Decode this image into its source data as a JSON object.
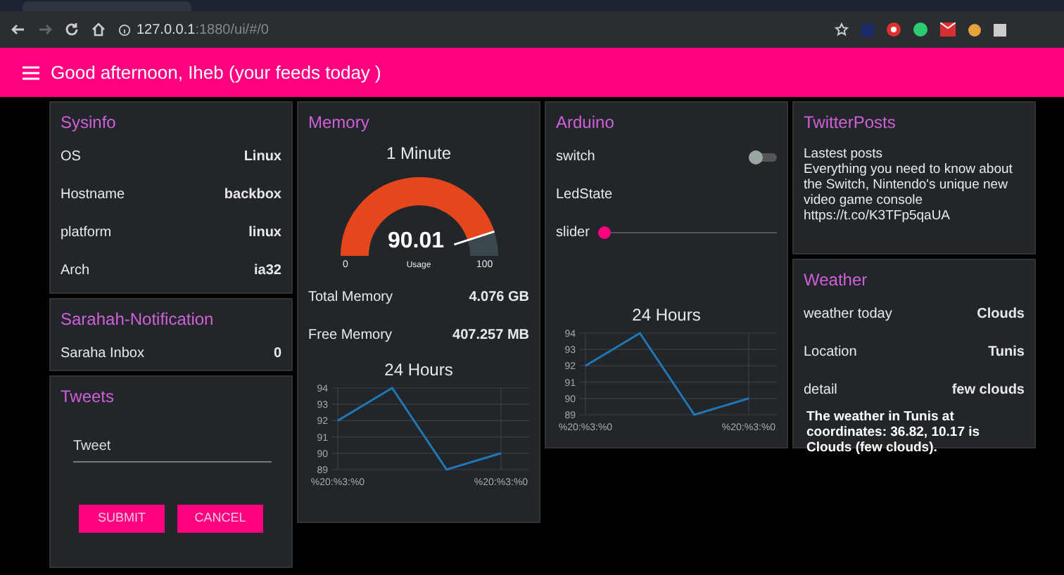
{
  "browser": {
    "url_host": "127.0.0.1",
    "url_path": ":1880/ui/#/0"
  },
  "header": {
    "title": "Good afternoon, Iheb (your feeds today )"
  },
  "sysinfo": {
    "title": "Sysinfo",
    "rows": [
      {
        "label": "OS",
        "value": "Linux"
      },
      {
        "label": "Hostname",
        "value": "backbox"
      },
      {
        "label": "platform",
        "value": "linux"
      },
      {
        "label": "Arch",
        "value": "ia32"
      }
    ]
  },
  "notification": {
    "title": "Sarahah-Notification",
    "rows": [
      {
        "label": "Saraha Inbox",
        "value": "0"
      }
    ]
  },
  "tweets": {
    "title": "Tweets",
    "field": {
      "placeholder": "Tweet"
    },
    "buttons": [
      "SUBMIT",
      "CANCEL"
    ]
  },
  "memory": {
    "title": "Memory",
    "gauge": {
      "title": "1 Minute",
      "value": "90.01",
      "min": "0",
      "max": "100",
      "label": "Usage"
    },
    "rows": [
      {
        "label": "Total Memory",
        "value": "4.076 GB"
      },
      {
        "label": "Free Memory",
        "value": "407.257 MB"
      }
    ],
    "chart": {
      "chart_data": {
        "type": "line",
        "title": "24 Hours",
        "categories": [
          "%20:%3:%0",
          null,
          null,
          "%20:%3:%0"
        ],
        "series": [
          {
            "color": "#1f77b4",
            "values": [
              92,
              94,
              89,
              90
            ]
          }
        ],
        "ylim": [
          89,
          94
        ],
        "yticks": [
          89,
          90,
          91,
          92,
          93,
          94
        ],
        "grid": true
      }
    }
  },
  "arduino": {
    "title": "Arduino",
    "switch": {
      "label": "switch",
      "on": false
    },
    "led": {
      "label": "LedState"
    },
    "slider": {
      "label": "slider",
      "level": 0
    },
    "chart": {
      "chart_data": {
        "type": "line",
        "title": "24 Hours",
        "categories": [
          "%20:%3:%0",
          null,
          null,
          "%20:%3:%0"
        ],
        "series": [
          {
            "color": "#1f77b4",
            "values": [
              92,
              94,
              89,
              90
            ]
          }
        ],
        "ylim": [
          89,
          94
        ],
        "yticks": [
          89,
          90,
          91,
          92,
          93,
          94
        ],
        "grid": true
      }
    }
  },
  "twitter_posts": {
    "title": "TwitterPosts",
    "lines": [
      "Lastest posts",
      "Everything you need to know about the Switch, Nintendo's unique new video game console",
      "https://t.co/K3TFp5qaUA"
    ]
  },
  "weather": {
    "title": "Weather",
    "rows": [
      {
        "label": "weather today",
        "value": "Clouds"
      },
      {
        "label": "Location",
        "value": "Tunis"
      },
      {
        "label": "detail",
        "value": "few clouds"
      }
    ],
    "summary": "The weather in Tunis at coordinates: 36.82, 10.17 is Clouds (few clouds)."
  }
}
